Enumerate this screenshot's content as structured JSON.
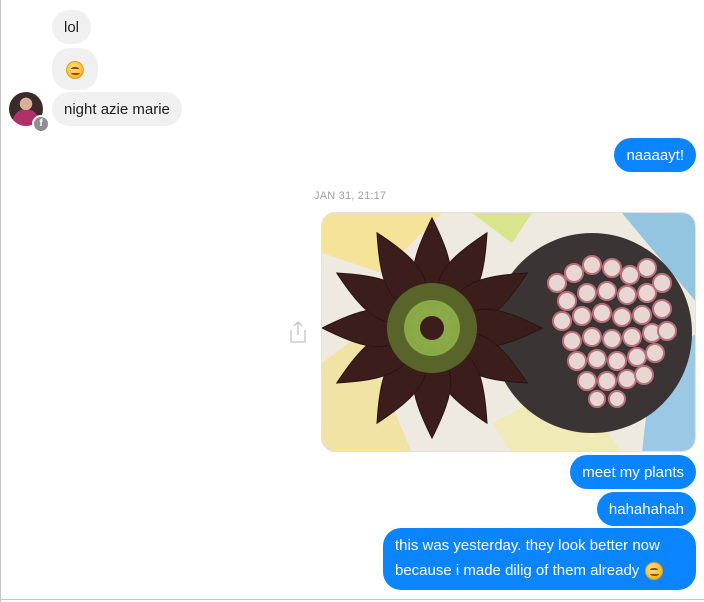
{
  "conversation": {
    "incoming": {
      "msg1": "lol",
      "msg2_emoji": "smiling-face-emoji",
      "msg3": "night azie marie"
    },
    "outgoing": {
      "msg1": "naaaayt!",
      "msg2": "meet my plants",
      "msg3": "hahahahah",
      "msg4_line1": "this was yesterday. they look better now",
      "msg4_line2": "because i made dilig of them already"
    },
    "timestamp": "JAN 31, 21:17",
    "attachment": {
      "type": "photo",
      "subject": "succulent plants"
    },
    "avatar_badge": "f"
  },
  "colors": {
    "outgoing_bubble": "#0a84ff",
    "incoming_bubble": "#f1f0f0",
    "timestamp_text": "#a0a0a0"
  },
  "icons": [
    "share-icon",
    "facebook-badge-icon",
    "smiling-face-emoji"
  ]
}
